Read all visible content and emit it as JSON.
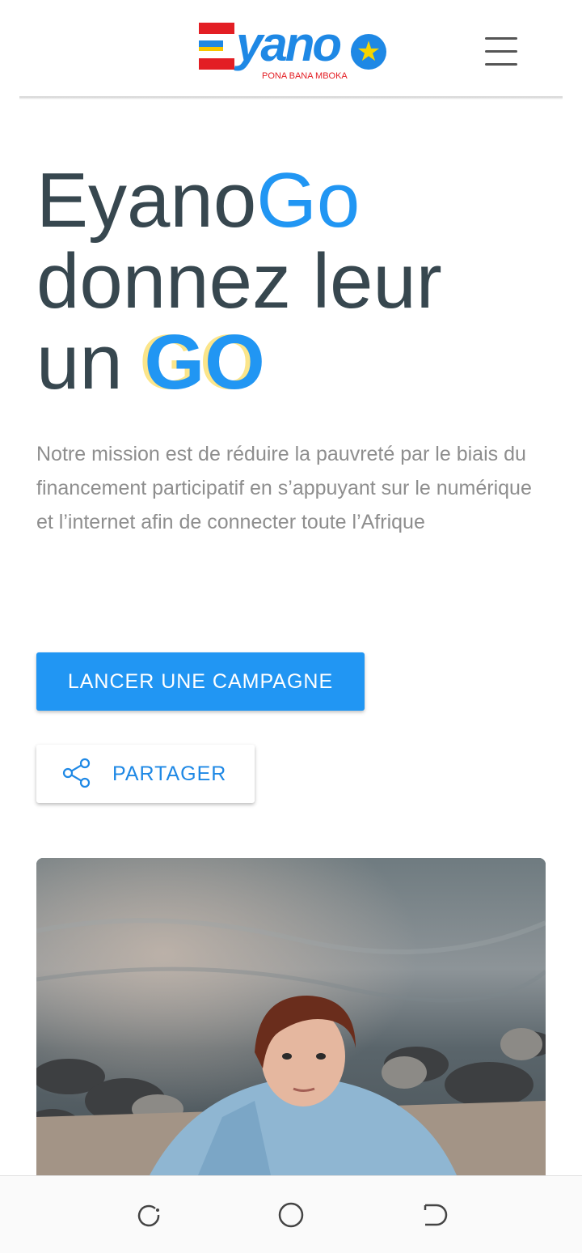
{
  "header": {
    "logo": {
      "text": "yano",
      "tagline": "PONA BANA MBOKA"
    },
    "menu_icon": "hamburger-menu-icon"
  },
  "hero": {
    "title_part1": "Eyano",
    "title_part2": "Go",
    "title_line2": "donnez leur",
    "title_line3_prefix": "un",
    "title_line3_go": "GO",
    "mission": "Notre mission est de réduire la pauvreté par le biais du financement participatif en s’appuyant sur le numérique et l’internet afin de connecter toute l’Afrique"
  },
  "actions": {
    "launch_label": "LANCER UNE CAMPAGNE",
    "share_label": "PARTAGER",
    "share_icon": "share-icon"
  },
  "colors": {
    "accent": "#2196f3",
    "title": "#37474f",
    "go_shadow": "#fbe58a",
    "text_muted": "#8e8e8e"
  },
  "navbar": {
    "icons": [
      "recent-apps-icon",
      "home-icon",
      "back-icon"
    ]
  }
}
